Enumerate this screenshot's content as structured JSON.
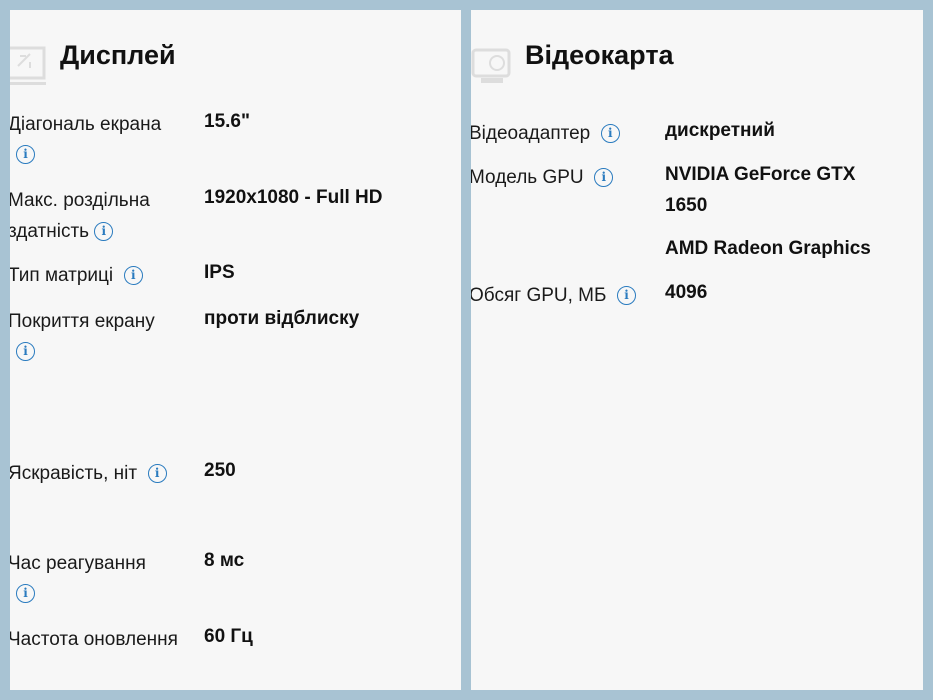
{
  "display": {
    "title": "Дисплей",
    "rows": [
      {
        "label": "Діагональ екрана",
        "value": "15.6\""
      },
      {
        "label": "Макс. роздільна",
        "label2": "здатність",
        "value": "1920x1080 - Full HD"
      },
      {
        "label": "Тип матриці",
        "value": "IPS"
      },
      {
        "label": "Покриття екрану",
        "value": "проти відблиску"
      },
      {
        "label": "Яскравість, ніт",
        "value": "250"
      },
      {
        "label": "Час реагування",
        "value": "8 мс"
      },
      {
        "label": "Частота оновлення",
        "value": "60 Гц"
      }
    ]
  },
  "gpu": {
    "title": "Відеокарта",
    "rows": [
      {
        "label": "Відеоадаптер",
        "value": "дискретний"
      },
      {
        "label": "Модель GPU",
        "value": "NVIDIA GeForce GTX",
        "value2": "1650",
        "value3": "AMD Radeon Graphics"
      },
      {
        "label": "Обсяг GPU, МБ",
        "value": "4096"
      }
    ]
  }
}
